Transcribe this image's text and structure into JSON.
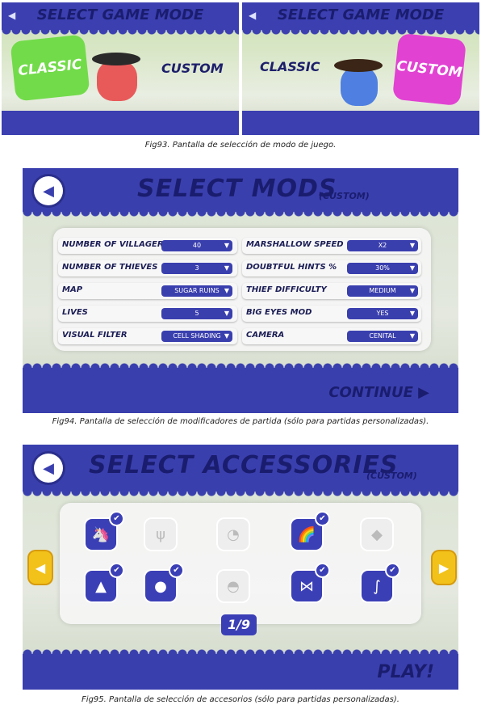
{
  "fig93": {
    "left": {
      "title": "SELECT GAME MODE",
      "classic": "CLASSIC",
      "custom": "CUSTOM"
    },
    "right": {
      "title": "SELECT GAME MODE",
      "classic": "CLASSIC",
      "custom": "CUSTOM"
    },
    "caption": "Fig93. Pantalla de selección de modo de juego."
  },
  "fig94": {
    "title": "SELECT MODS",
    "subtitle": "(CUSTOM)",
    "left_rows": [
      {
        "label": "NUMBER OF VILLAGERS",
        "value": "40"
      },
      {
        "label": "NUMBER OF THIEVES",
        "value": "3"
      },
      {
        "label": "MAP",
        "value": "SUGAR RUINS"
      },
      {
        "label": "LIVES",
        "value": "5"
      },
      {
        "label": "VISUAL FILTER",
        "value": "CELL SHADING"
      }
    ],
    "right_rows": [
      {
        "label": "MARSHALLOW SPEED",
        "value": "X2"
      },
      {
        "label": "DOUBTFUL HINTS %",
        "value": "30%"
      },
      {
        "label": "THIEF DIFFICULTY",
        "value": "MEDIUM"
      },
      {
        "label": "BIG EYES MOD",
        "value": "YES"
      },
      {
        "label": "CAMERA",
        "value": "CENITAL"
      }
    ],
    "continue": "CONTINUE",
    "caption": "Fig94. Pantalla de selección de modificadores de partida (sólo para partidas personalizadas)."
  },
  "fig95": {
    "title": "SELECT ACCESSORIES",
    "subtitle": "(CUSTOM)",
    "page": "1/9",
    "play": "PLAY!",
    "caption": "Fig95. Pantalla de selección de accesorios (sólo para partidas personalizadas).",
    "accessories": [
      {
        "icon": "unicorn-horn-icon",
        "glyph": "🦄",
        "selected": true
      },
      {
        "icon": "antlers-icon",
        "glyph": "ψ",
        "selected": false
      },
      {
        "icon": "earmuffs-icon",
        "glyph": "◔",
        "selected": false
      },
      {
        "icon": "rainbow-icon",
        "glyph": "🌈",
        "selected": true
      },
      {
        "icon": "gem-icon",
        "glyph": "◆",
        "selected": false
      },
      {
        "icon": "party-hat-icon",
        "glyph": "▲",
        "selected": true
      },
      {
        "icon": "bowler-hat-icon",
        "glyph": "●",
        "selected": true
      },
      {
        "icon": "beanie-icon",
        "glyph": "◓",
        "selected": false
      },
      {
        "icon": "bow-tie-icon",
        "glyph": "⋈",
        "selected": true
      },
      {
        "icon": "cane-icon",
        "glyph": "∫",
        "selected": true
      }
    ]
  },
  "back_glyph": "◀",
  "next_glyph": "▶",
  "check_glyph": "✔",
  "dropdown_glyph": "▼"
}
